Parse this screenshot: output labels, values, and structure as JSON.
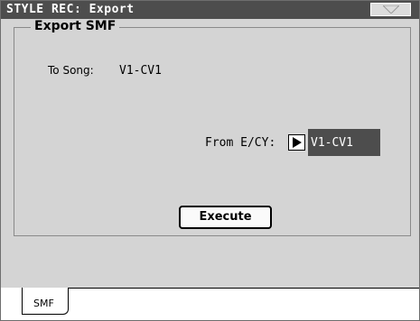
{
  "window": {
    "title": "STYLE REC: Export",
    "menu_icon": "triangle-down-icon"
  },
  "panel": {
    "title": "Export SMF",
    "to_song_label": "To Song:",
    "to_song_value": "V1-CV1",
    "from_label": "From E/CY:",
    "from_value": "V1-CV1",
    "play_icon": "play-triangle-icon",
    "execute_label": "Execute"
  },
  "tabs": [
    {
      "label": "SMF",
      "active": true
    }
  ],
  "colors": {
    "title_bar": "#4d4d4d",
    "background": "#d4d4d4",
    "highlight": "#4d4d4d"
  }
}
